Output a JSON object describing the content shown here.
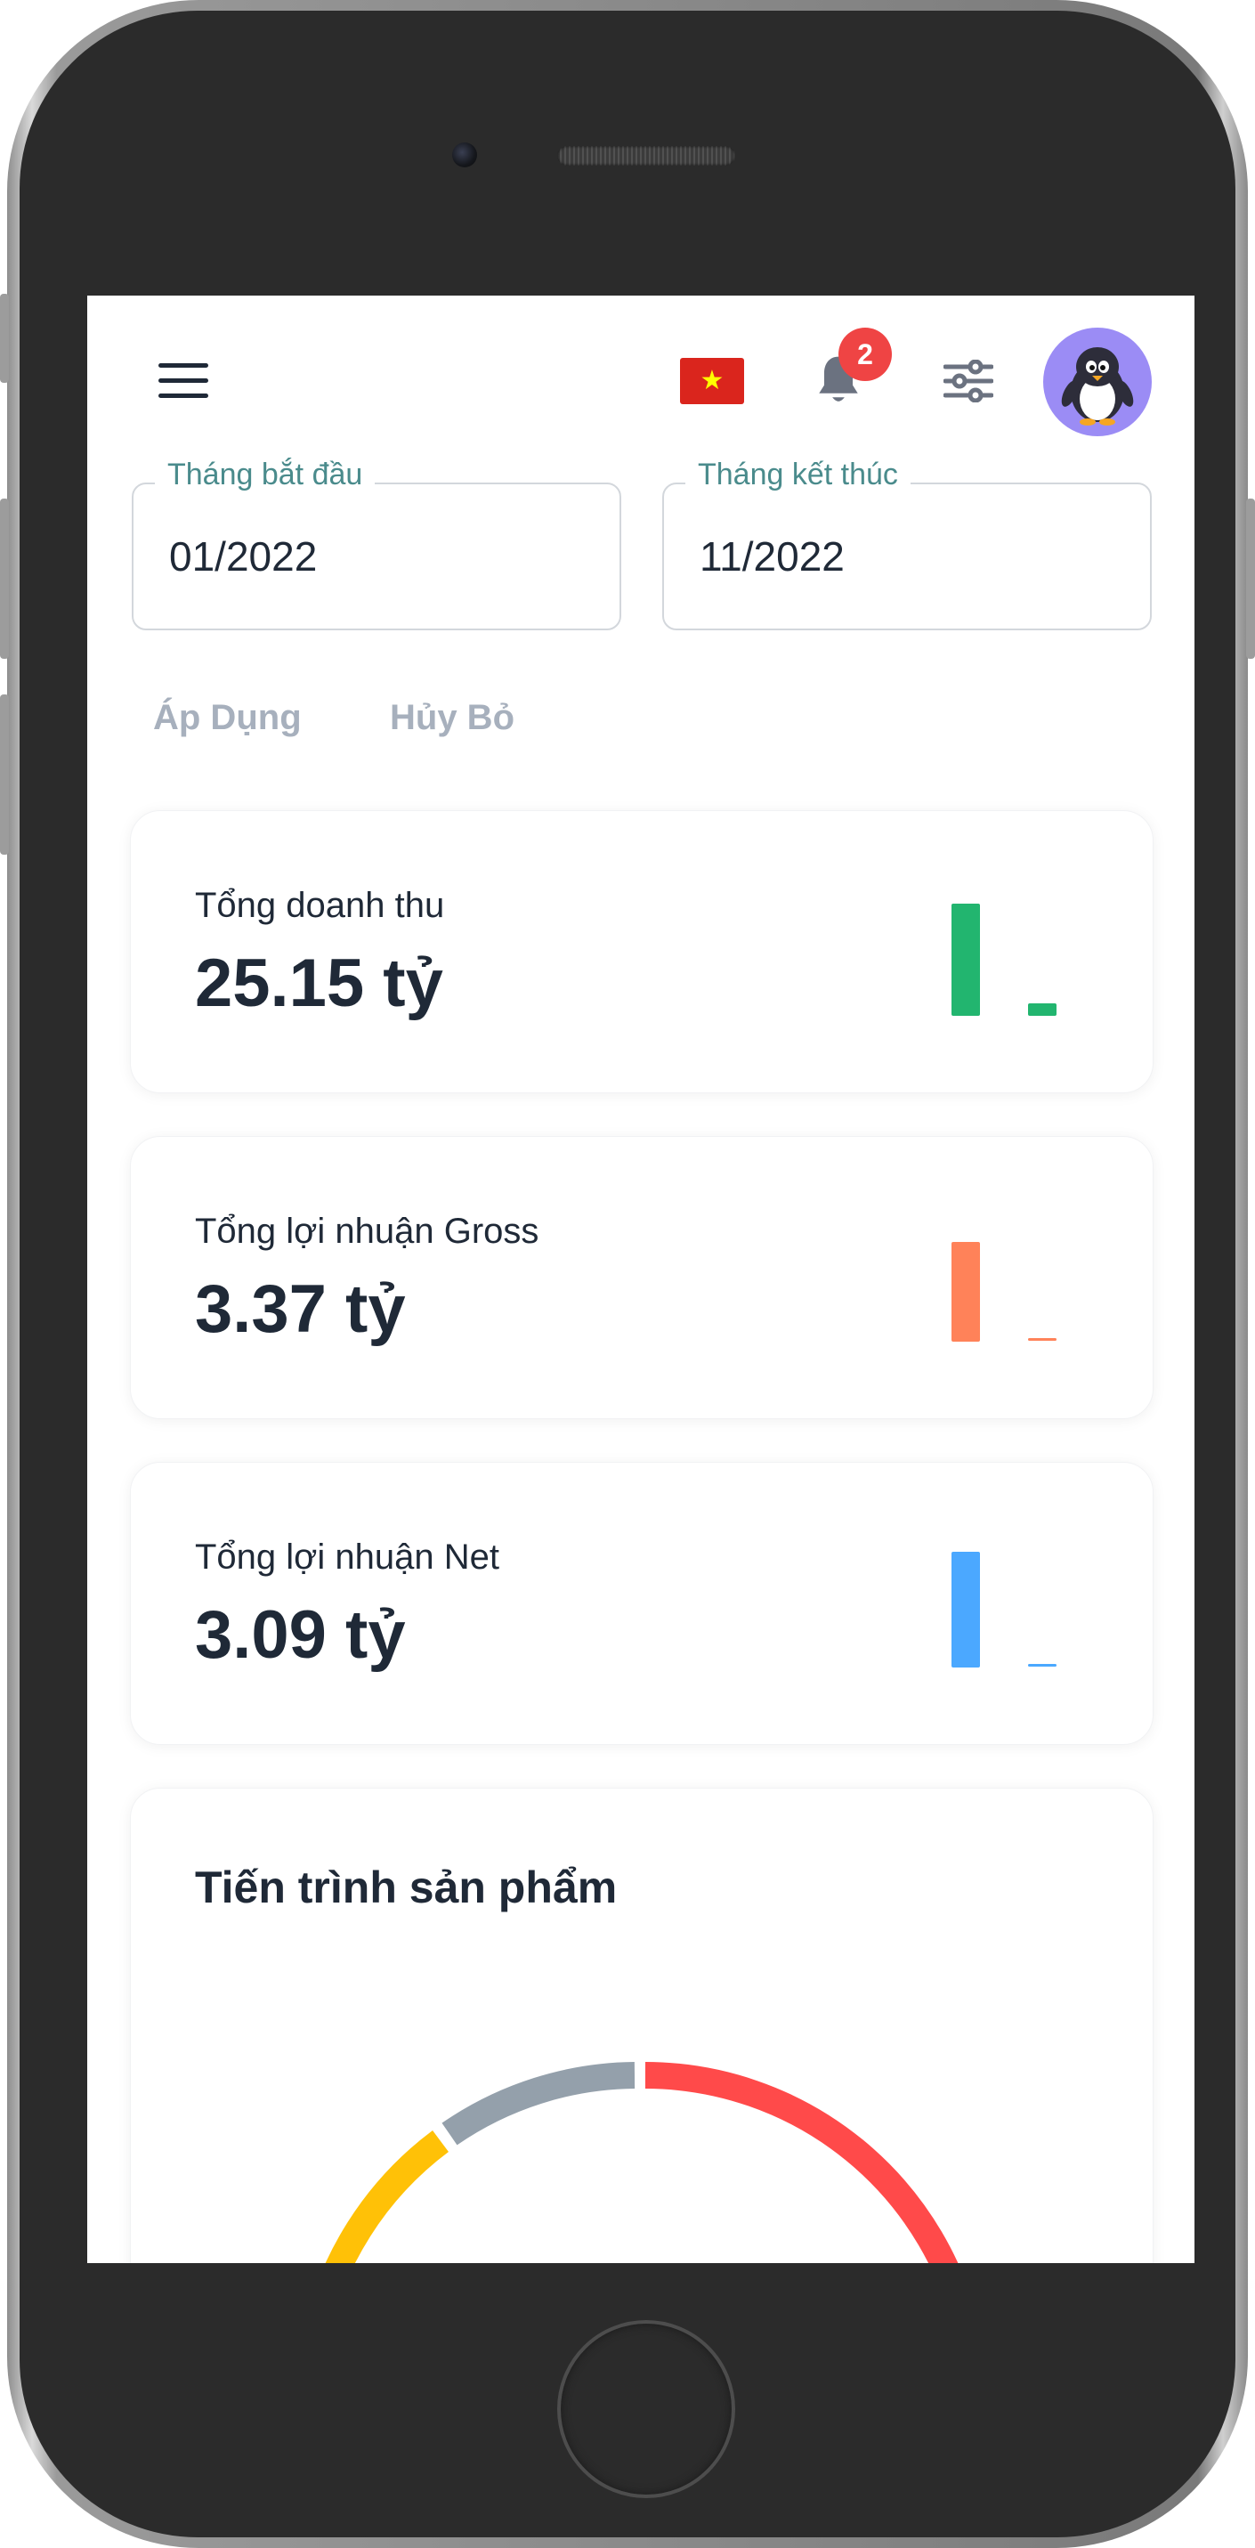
{
  "header": {
    "flag_icon": "vietnam-flag-icon",
    "notification_count": "2",
    "accent_color": "#a5a0f5"
  },
  "filters": {
    "start_label": "Tháng bắt đầu",
    "start_value": "01/2022",
    "end_label": "Tháng kết thúc",
    "end_value": "11/2022",
    "apply_label": "Áp Dụng",
    "cancel_label": "Hủy Bỏ"
  },
  "cards": [
    {
      "title": "Tổng doanh thu",
      "value": "25.15 tỷ",
      "color": "#22b56f"
    },
    {
      "title": "Tổng lợi nhuận Gross",
      "value": "3.37 tỷ",
      "color": "#ff8259"
    },
    {
      "title": "Tổng lợi nhuận Net",
      "value": "3.09 tỷ",
      "color": "#4ba8ff"
    }
  ],
  "progress": {
    "title": "Tiến trình sản phẩm",
    "colors": [
      "#ff4a4a",
      "#ffc107",
      "#94a0ab"
    ]
  }
}
